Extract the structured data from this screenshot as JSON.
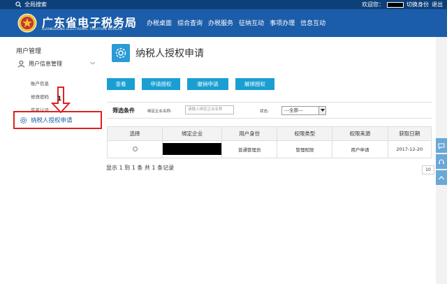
{
  "topbar": {
    "search_label": "全局搜索",
    "welcome": "欢迎您：",
    "switch_identity": "切换身份",
    "logout": "退出"
  },
  "header": {
    "brand_cn": "广东省电子税务局",
    "brand_en": "GUANGDONG ELECTRONIC TAXATION BUREAU",
    "nav": [
      "办税桌面",
      "综合查询",
      "办税服务",
      "征纳互动",
      "事项办理",
      "信息互动"
    ]
  },
  "sidebar": {
    "title": "用户管理",
    "group": "用户信息管理",
    "items": [
      "账户信息",
      "修改密码",
      "实名认证"
    ],
    "active": "纳税人授权申请"
  },
  "annotation": {
    "number": "1"
  },
  "main": {
    "title": "纳税人授权申请",
    "buttons": [
      "查看",
      "申请授权",
      "撤销申请",
      "解绑授权"
    ],
    "filter": {
      "label": "筛选条件",
      "enterprise_label": "绑定企业名称:",
      "enterprise_placeholder": "请输入绑定企业名称",
      "status_label": "状态:",
      "status_value": "---全部---"
    },
    "table": {
      "headers": [
        "选择",
        "绑定企业",
        "用户身份",
        "权限类型",
        "权限来源",
        "获取日期"
      ],
      "rows": [
        {
          "identity": "普通管理员",
          "permission_type": "管理权限",
          "source": "用户申请",
          "date": "2017-12-20"
        }
      ]
    },
    "summary": "显示 1 到 1 条 共 1 条记录",
    "page_size": "10"
  },
  "colors": {
    "topbar": "#0d3f78",
    "header": "#1b5da9",
    "button": "#1a9fd3",
    "highlight": "#e02020"
  }
}
